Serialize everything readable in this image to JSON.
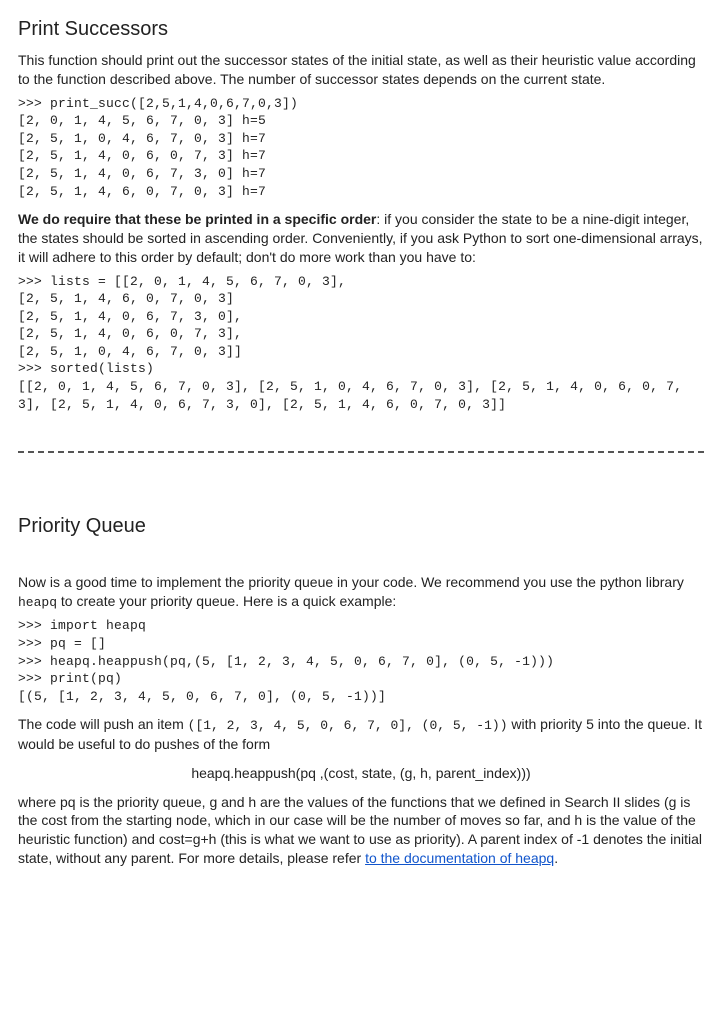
{
  "section1": {
    "heading": "Print Successors",
    "intro": "This function should print out the successor states of the initial state, as well as their heuristic value according to the function described above. The number of successor states depends on the current state.",
    "code1": ">>> print_succ([2,5,1,4,0,6,7,0,3])\n[2, 0, 1, 4, 5, 6, 7, 0, 3] h=5\n[2, 5, 1, 0, 4, 6, 7, 0, 3] h=7\n[2, 5, 1, 4, 0, 6, 0, 7, 3] h=7\n[2, 5, 1, 4, 0, 6, 7, 3, 0] h=7\n[2, 5, 1, 4, 6, 0, 7, 0, 3] h=7",
    "order_bold": "We do require that these be printed in a specific order",
    "order_rest": ": if you consider the state to be a nine-digit integer, the states should be sorted in ascending order. Conveniently, if you ask Python to sort one-dimensional arrays, it will adhere to this order by default; don't do more work than you have to:",
    "code2": ">>> lists = [[2, 0, 1, 4, 5, 6, 7, 0, 3],\n[2, 5, 1, 4, 6, 0, 7, 0, 3]\n[2, 5, 1, 4, 0, 6, 7, 3, 0],\n[2, 5, 1, 4, 0, 6, 0, 7, 3],\n[2, 5, 1, 0, 4, 6, 7, 0, 3]]\n>>> sorted(lists)\n[[2, 0, 1, 4, 5, 6, 7, 0, 3], [2, 5, 1, 0, 4, 6, 7, 0, 3], [2, 5, 1, 4, 0, 6, 0, 7, 3], [2, 5, 1, 4, 0, 6, 7, 3, 0], [2, 5, 1, 4, 6, 0, 7, 0, 3]]"
  },
  "section2": {
    "heading": "Priority Queue",
    "intro_pre": "Now is a good time to implement the priority queue in your code. We recommend you use the python library ",
    "intro_code": "heapq",
    "intro_post": " to create your priority queue. Here is a quick example:",
    "code": ">>> import heapq\n>>> pq = []\n>>> heapq.heappush(pq,(5, [1, 2, 3, 4, 5, 0, 6, 7, 0], (0, 5, -1)))\n>>> print(pq)\n[(5, [1, 2, 3, 4, 5, 0, 6, 7, 0], (0, 5, -1))]",
    "after_pre": "The code will push an item ",
    "after_code": "([1, 2, 3, 4, 5, 0, 6, 7, 0], (0, 5, -1))",
    "after_post": " with priority 5 into the queue. It would be useful to do pushes of the form",
    "pushform": "heapq.heappush(pq ,(cost, state, (g, h, parent_index)))",
    "explain_pre": "where pq is the priority queue, g and h are the values of the functions that we defined in Search II slides (g is the cost from the starting node, which in our case will be the number of moves so far, and h is the value of the heuristic function) and cost=g+h (this is what we want to use as priority). A parent index of -1 denotes the initial state, without any parent. For more details, please refer ",
    "link_text": "to the documentation of heapq",
    "explain_post": "."
  }
}
